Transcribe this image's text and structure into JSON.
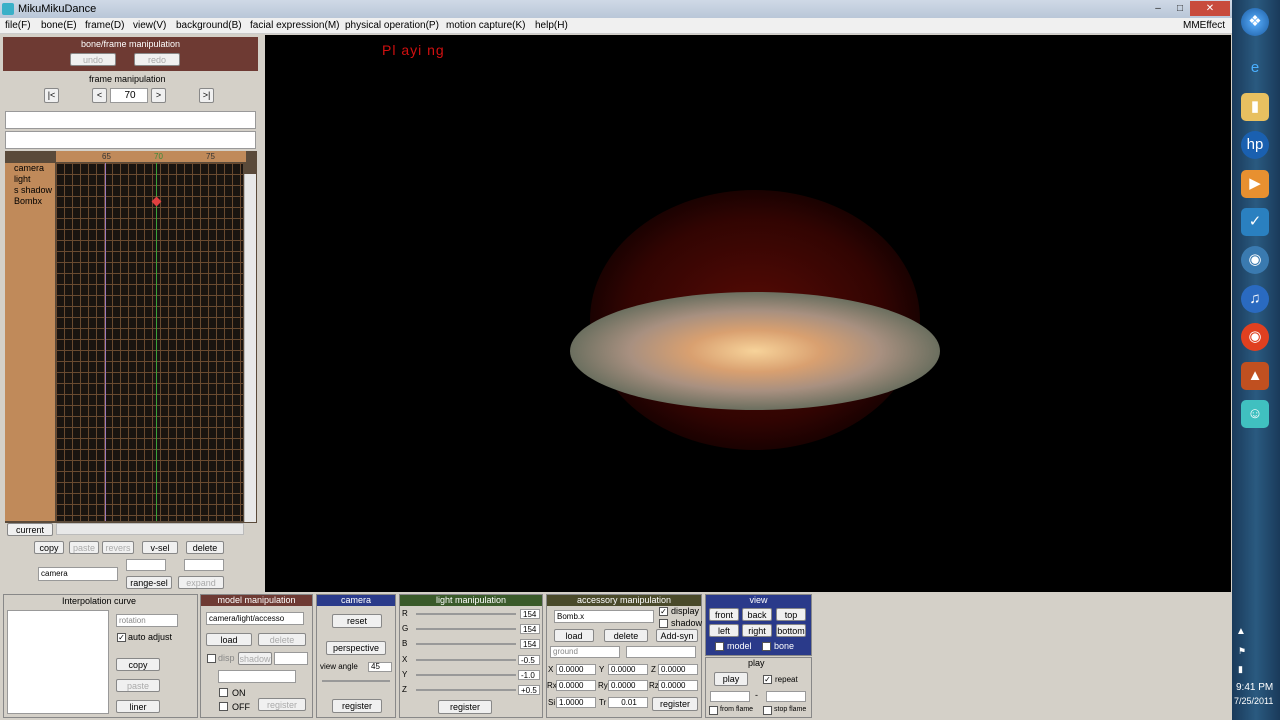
{
  "window": {
    "title": "MikuMikuDance",
    "menu_right": "MMEffect"
  },
  "menu": [
    "file(F)",
    "bone(E)",
    "frame(D)",
    "view(V)",
    "background(B)",
    "facial expression(M)",
    "physical operation(P)",
    "motion capture(K)",
    "help(H)"
  ],
  "viewport": {
    "status": "Pl ayi ng"
  },
  "bone_frame": {
    "title": "bone/frame manipulation",
    "undo": "undo",
    "redo": "redo"
  },
  "frame_manip": {
    "title": "frame manipulation",
    "first": "|<",
    "prev": "<",
    "frame": "70",
    "next": ">",
    "last": ">|"
  },
  "timeline": {
    "ruler": [
      "65",
      "70",
      "75"
    ],
    "tracks": [
      "camera",
      "light",
      "s shadow",
      "Bombx"
    ],
    "current_label": "current"
  },
  "left_buttons": {
    "copy": "copy",
    "paste": "paste",
    "revers": "revers",
    "vsel": "v-sel",
    "delete": "delete",
    "select_value": "camera",
    "range_sel": "range-sel",
    "expand": "expand"
  },
  "interp": {
    "title": "Interpolation curve",
    "select_value": "rotation",
    "auto_adjust": "auto adjust",
    "copy": "copy",
    "paste": "paste",
    "liner": "liner"
  },
  "model": {
    "title": "model manipulation",
    "select_value": "camera/light/accesso",
    "load": "load",
    "delete": "delete",
    "disp": "disp",
    "shadow": "shadow",
    "on": "ON",
    "off": "OFF",
    "register": "register"
  },
  "camera": {
    "title": "camera",
    "reset": "reset",
    "perspective": "perspective",
    "view_angle_label": "view angle",
    "view_angle": "45",
    "register": "register"
  },
  "light": {
    "title": "light manipulation",
    "r": "R",
    "g": "G",
    "b": "B",
    "x": "X",
    "y": "Y",
    "z": "Z",
    "rv": "154",
    "gv": "154",
    "bv": "154",
    "xv": "-0.5",
    "yv": "-1.0",
    "zv": "+0.5",
    "register": "register"
  },
  "accessory": {
    "title": "accessory manipulation",
    "select_value": "Bomb.x",
    "display": "display",
    "shadow": "shadow",
    "load": "load",
    "delete": "delete",
    "add_syn": "Add-syn",
    "ground": "ground",
    "x": "X",
    "y": "Y",
    "z": "Z",
    "rx": "Rx",
    "ry": "Ry",
    "rz": "Rz",
    "si": "Si",
    "tr": "Tr",
    "xv": "0.0000",
    "yv": "0.0000",
    "zv": "0.0000",
    "rxv": "0.0000",
    "ryv": "0.0000",
    "rzv": "0.0000",
    "siv": "1.0000",
    "trv": "0.01",
    "register": "register"
  },
  "view": {
    "title": "view",
    "front": "front",
    "back": "back",
    "top": "top",
    "left": "left",
    "right": "right",
    "bottom": "bottom",
    "model": "model",
    "bone": "bone"
  },
  "play": {
    "title": "play",
    "play": "play",
    "repeat": "repeat",
    "dash": "-",
    "from_frame": "from flame",
    "stop_frame": "stop flame"
  },
  "clock": {
    "time": "9:41 PM",
    "date": "7/25/2011"
  },
  "colors": {
    "accent_red": "#6e3a33",
    "panel_blue": "#2a3a8a",
    "panel_green": "#3a5a2a",
    "panel_olive": "#4a4a2a"
  }
}
